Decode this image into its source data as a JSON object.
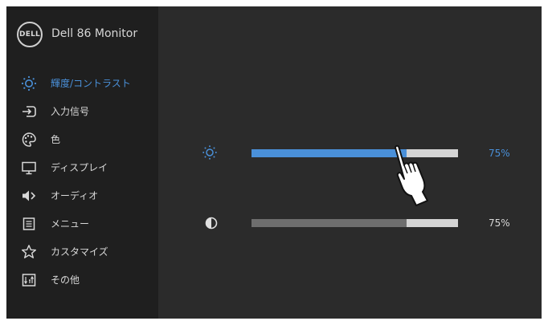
{
  "header": {
    "brand": "DELL",
    "model": "Dell 86 Monitor"
  },
  "menu": {
    "items": [
      {
        "label": "輝度/コントラスト",
        "icon": "brightness-icon",
        "active": true
      },
      {
        "label": "入力信号",
        "icon": "input-source-icon",
        "active": false
      },
      {
        "label": "色",
        "icon": "color-palette-icon",
        "active": false
      },
      {
        "label": "ディスプレイ",
        "icon": "display-icon",
        "active": false
      },
      {
        "label": "オーディオ",
        "icon": "speaker-icon",
        "active": false
      },
      {
        "label": "メニュー",
        "icon": "menu-icon",
        "active": false
      },
      {
        "label": "カスタマイズ",
        "icon": "star-icon",
        "active": false
      },
      {
        "label": "その他",
        "icon": "other-settings-icon",
        "active": false
      }
    ]
  },
  "controls": {
    "brightness": {
      "value": 75,
      "label": "75%",
      "icon": "brightness-icon",
      "color": "#4a90d9"
    },
    "contrast": {
      "value": 75,
      "label": "75%",
      "icon": "contrast-icon",
      "color": "#6e6e6e"
    }
  },
  "colors": {
    "accent": "#4a90d9",
    "sidebar_bg": "#1f1f1f",
    "panel_bg": "#2b2b2b"
  }
}
